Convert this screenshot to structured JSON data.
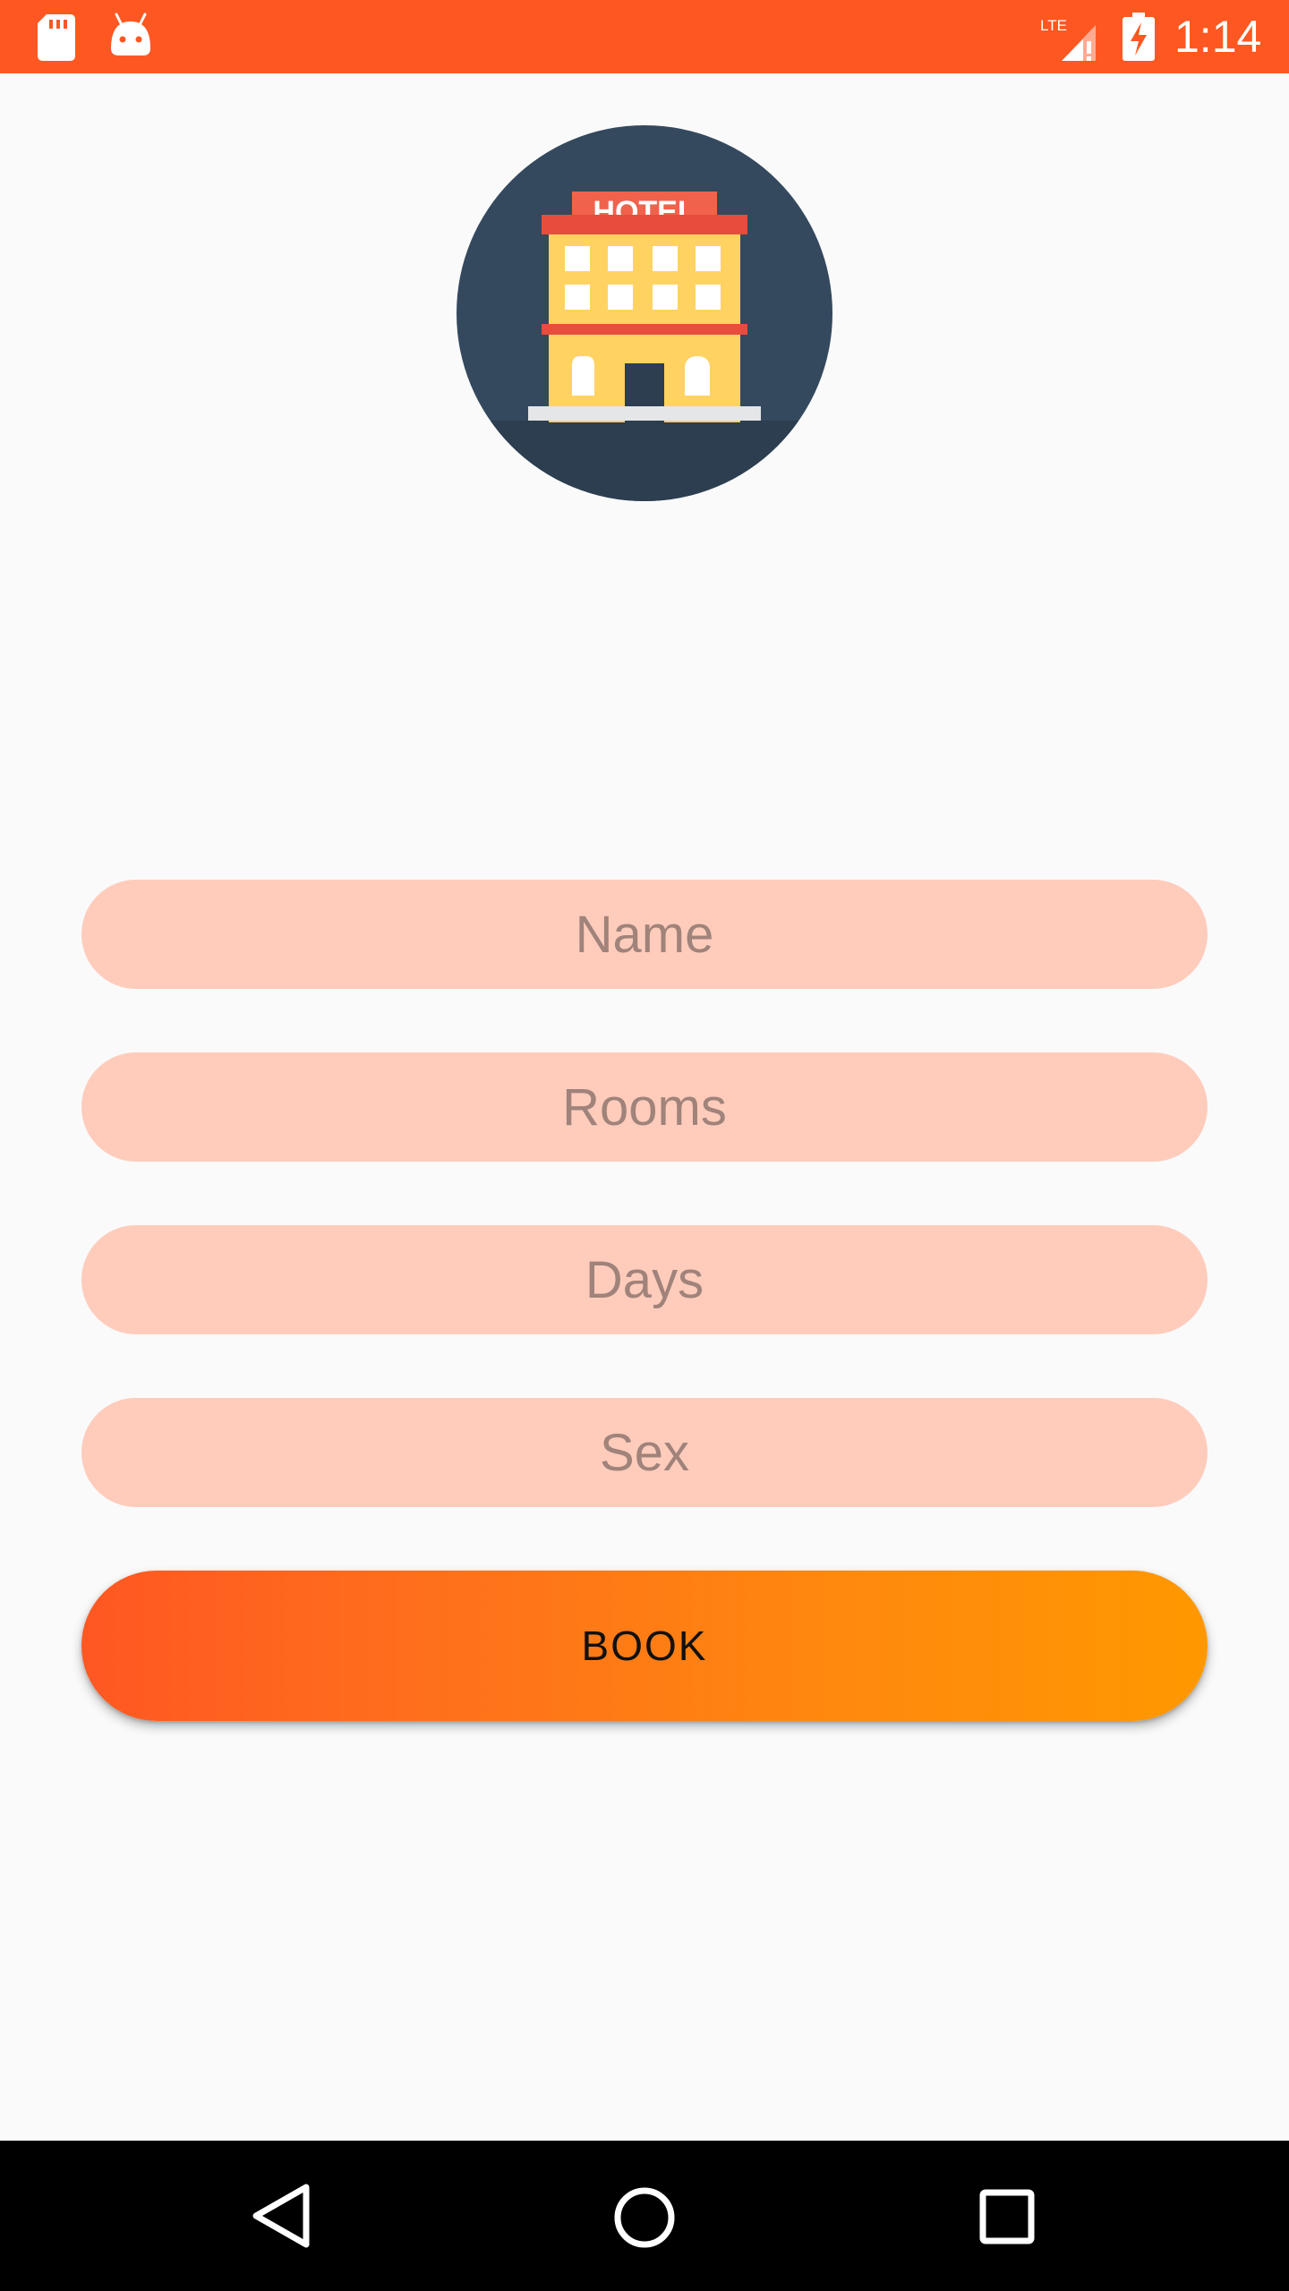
{
  "status_bar": {
    "time": "1:14",
    "network_label": "LTE",
    "background_color": "#FF5722",
    "icons": [
      "sd-card-icon",
      "android-debug-icon",
      "lte-signal-icon",
      "battery-charging-icon"
    ]
  },
  "logo": {
    "sign_text": "HOTEL",
    "icon": "hotel-building-icon"
  },
  "form": {
    "name_placeholder": "Name",
    "rooms_placeholder": "Rooms",
    "days_placeholder": "Days",
    "sex_placeholder": "Sex",
    "field_color": "#FFCCBC",
    "book_label": "BOOK",
    "book_gradient": [
      "#FF5722",
      "#FF9800"
    ]
  },
  "nav_bar": {
    "icons": [
      "back-icon",
      "home-icon",
      "recents-icon"
    ]
  }
}
